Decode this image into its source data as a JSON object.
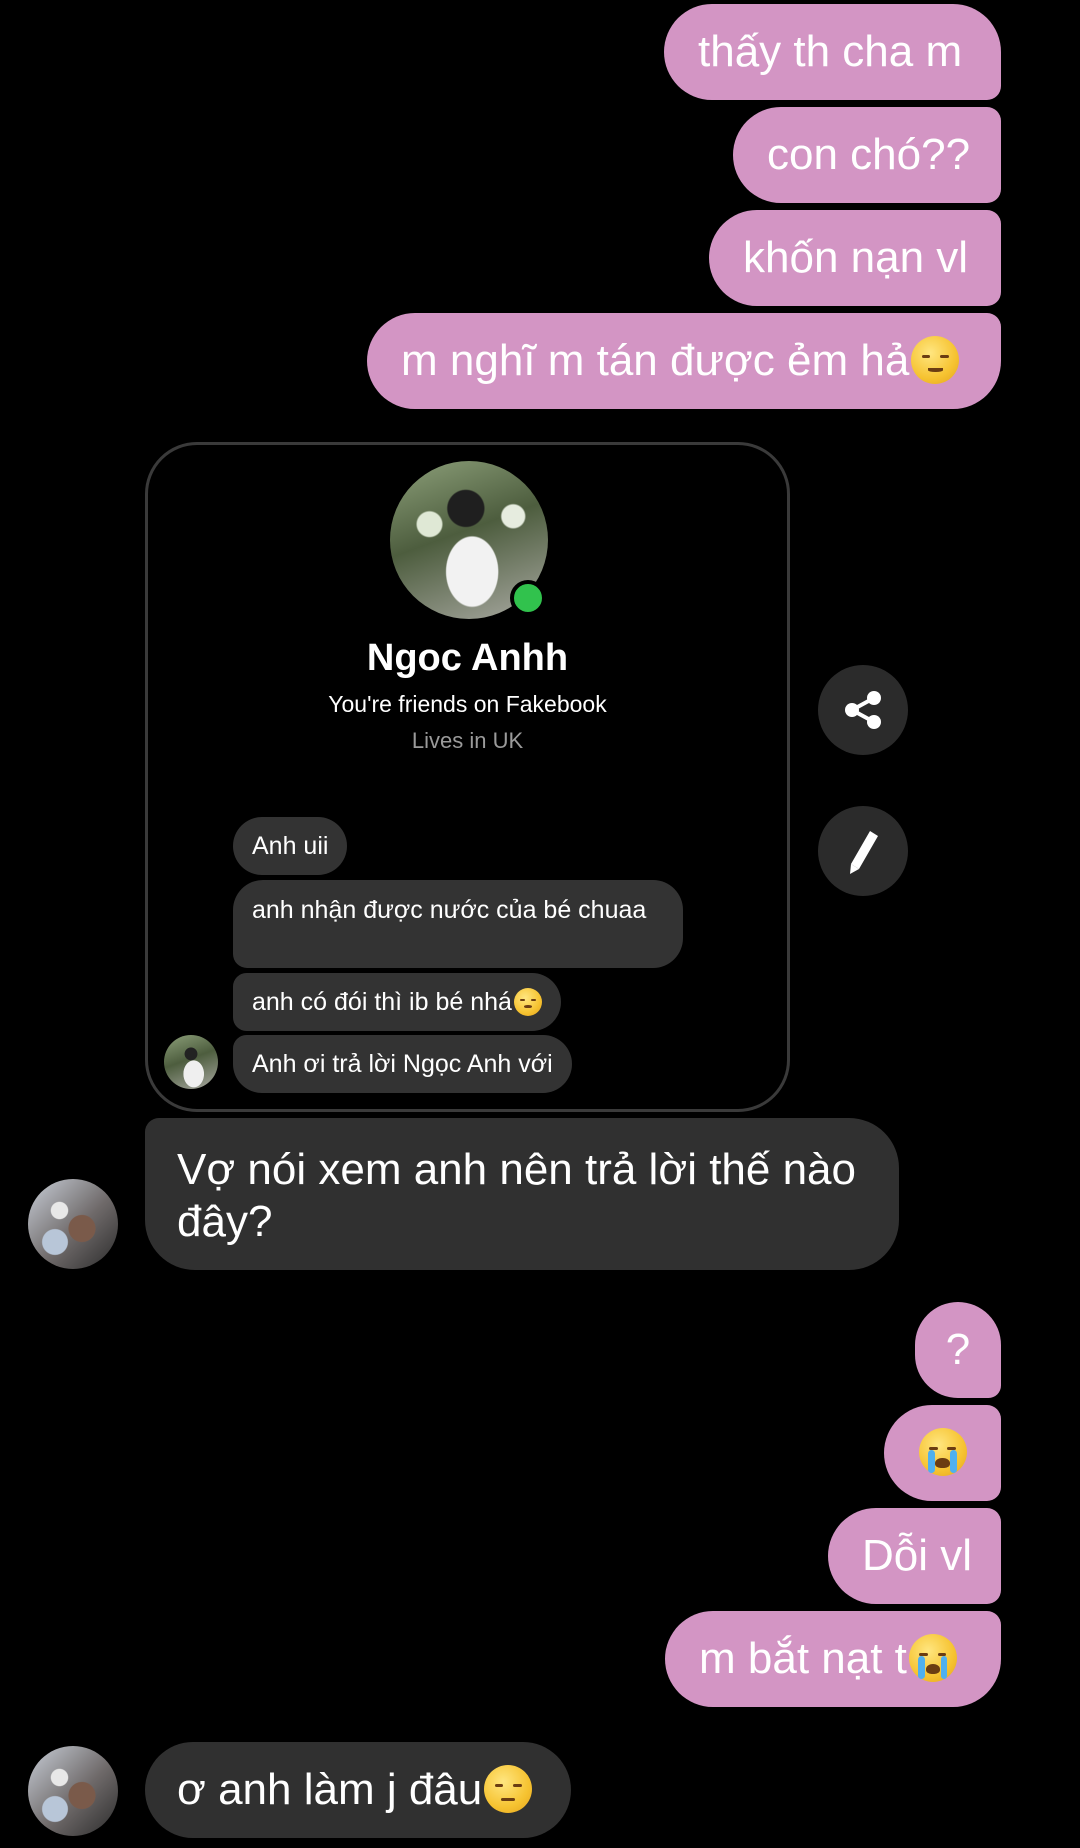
{
  "messages_top": [
    "thấy th cha m",
    "con chó??",
    "khốn nạn vl",
    "m nghĩ m tán được ẻm hả"
  ],
  "shared_card": {
    "name": "Ngoc Anhh",
    "friends_line": "You're friends on Fakebook",
    "lives_line": "Lives in UK",
    "messages": [
      "Anh uii",
      "anh nhận được nước của bé chuaa",
      "anh có đói thì ib bé nhá",
      "Anh ơi trả lời Ngọc Anh với"
    ]
  },
  "incoming_1": "Vợ nói xem anh nên trả lời thế nào đây?",
  "messages_mid": [
    "?",
    "Dỗi vl",
    "m bắt nạt t"
  ],
  "incoming_2": "ơ anh làm j đâu",
  "icons": {
    "share": "share-icon",
    "edit": "pencil-icon",
    "emoji_relieved": "relieved-face-emoji",
    "emoji_pleading": "pleading-face-emoji",
    "emoji_crying": "loudly-crying-face-emoji",
    "emoji_persevere": "persevering-face-emoji"
  },
  "colors": {
    "outgoing_bubble": "#d395c4",
    "incoming_bubble": "#303030",
    "online": "#31c24d"
  }
}
